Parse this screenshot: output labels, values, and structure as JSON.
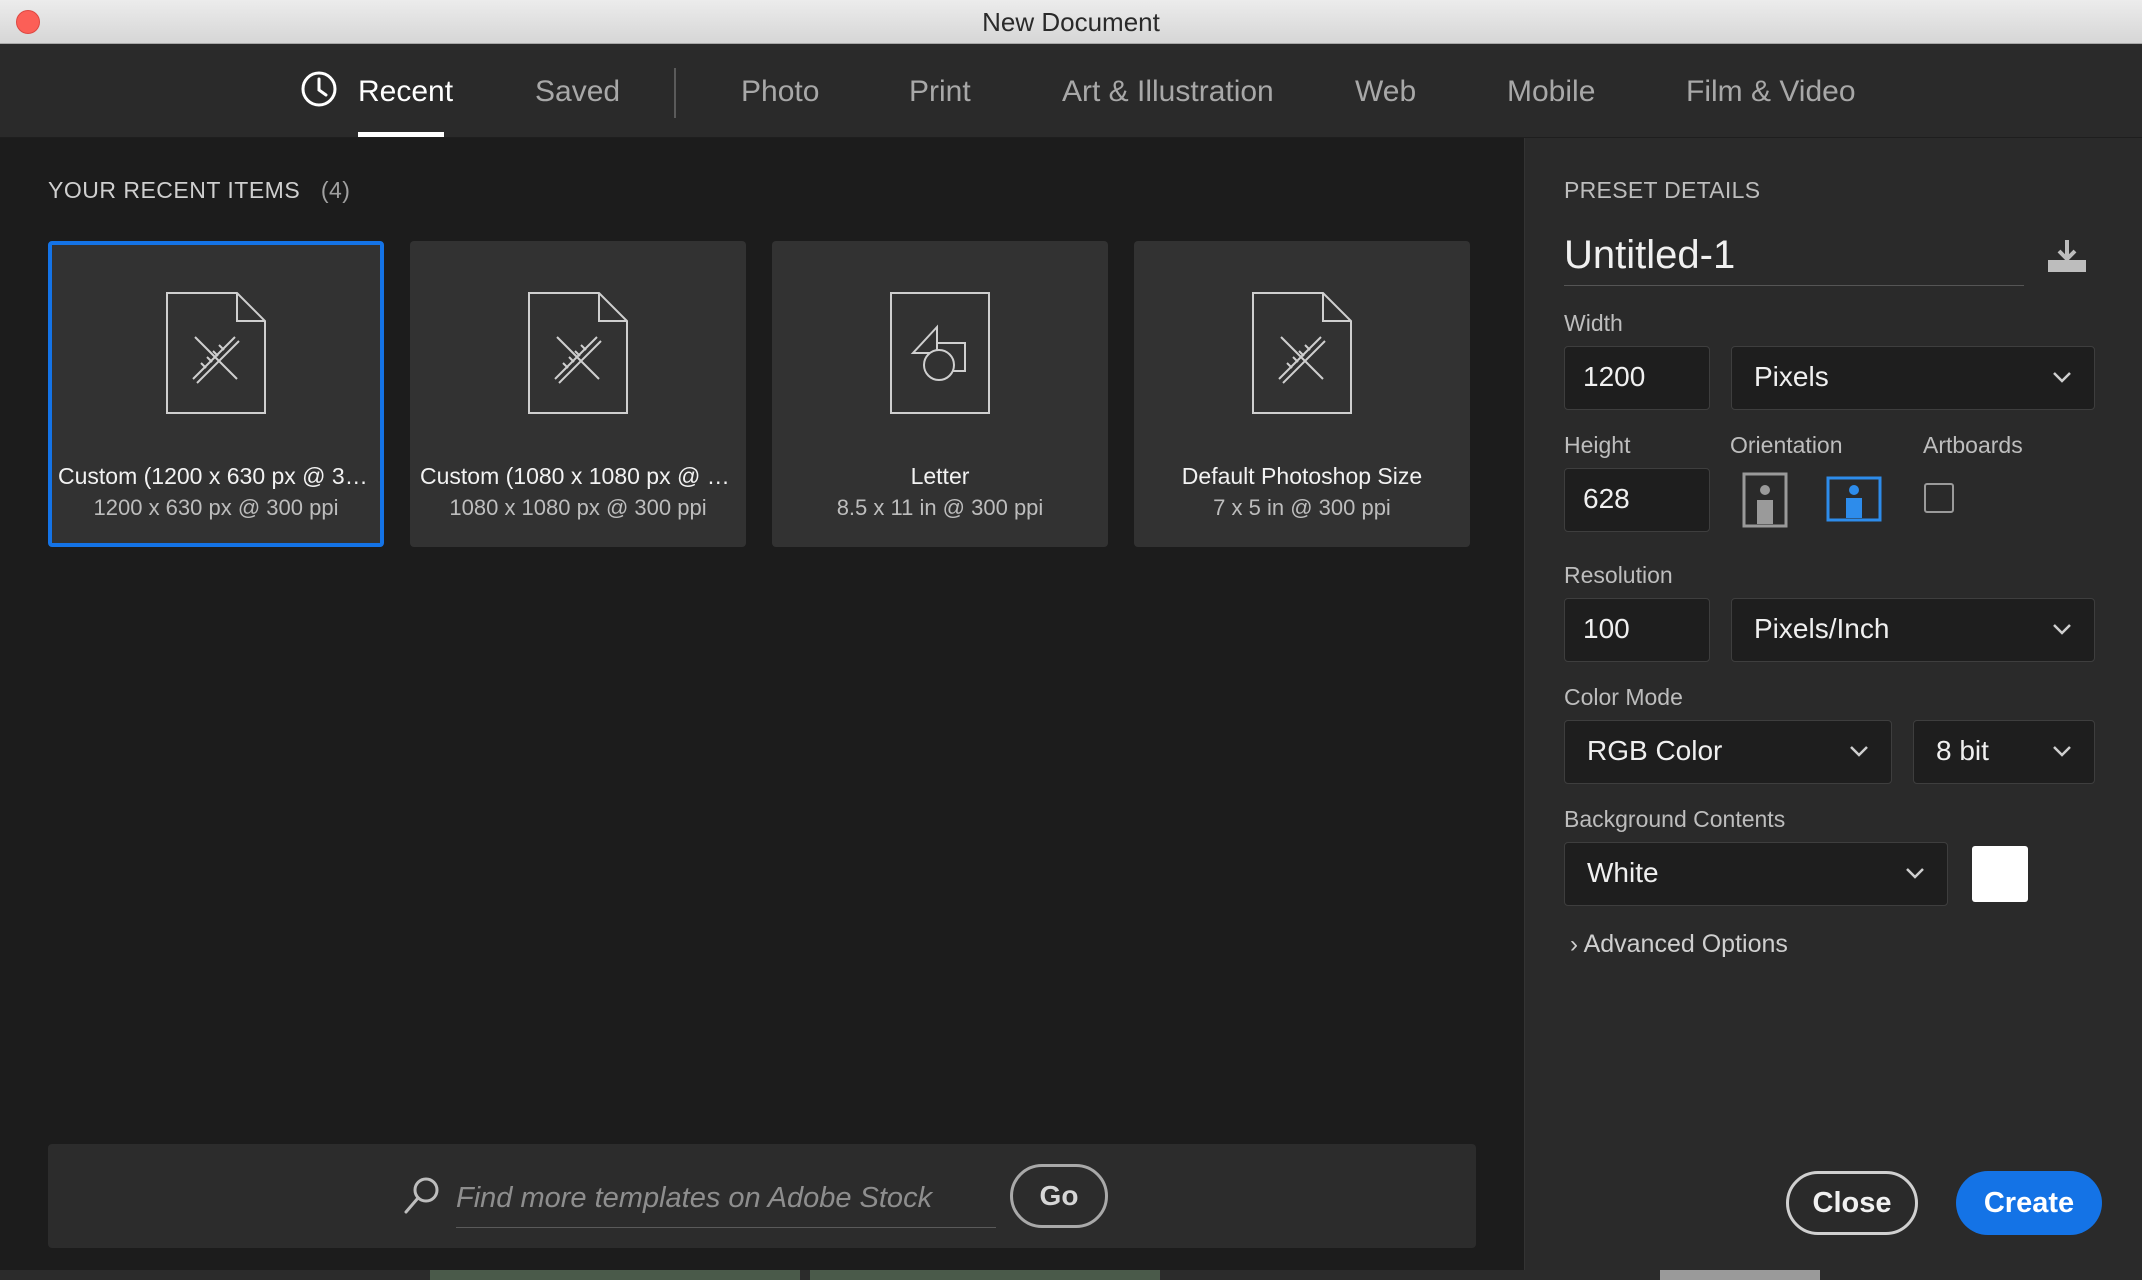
{
  "window": {
    "title": "New Document"
  },
  "tabs": [
    {
      "label": "Recent",
      "active": true
    },
    {
      "label": "Saved"
    },
    {
      "label": "Photo"
    },
    {
      "label": "Print"
    },
    {
      "label": "Art & Illustration"
    },
    {
      "label": "Web"
    },
    {
      "label": "Mobile"
    },
    {
      "label": "Film & Video"
    }
  ],
  "recent": {
    "title": "YOUR RECENT ITEMS",
    "count": "(4)",
    "items": [
      {
        "name": "Custom (1200 x 630 px @ 30...",
        "sub": "1200 x 630 px @ 300 ppi",
        "icon": "custom-document-icon"
      },
      {
        "name": "Custom (1080 x 1080 px @ 3...",
        "sub": "1080 x 1080 px @ 300 ppi",
        "icon": "custom-document-icon"
      },
      {
        "name": "Letter",
        "sub": "8.5 x 11 in @ 300 ppi",
        "icon": "print-document-icon"
      },
      {
        "name": "Default Photoshop Size",
        "sub": "7 x 5 in @ 300 ppi",
        "icon": "custom-document-icon"
      }
    ]
  },
  "stock": {
    "placeholder": "Find more templates on Adobe Stock",
    "go_label": "Go"
  },
  "preset": {
    "title": "PRESET DETAILS",
    "name": "Untitled-1",
    "width_label": "Width",
    "width_value": "1200",
    "width_unit": "Pixels",
    "height_label": "Height",
    "height_value": "628",
    "orientation_label": "Orientation",
    "artboards_label": "Artboards",
    "resolution_label": "Resolution",
    "resolution_value": "100",
    "resolution_unit": "Pixels/Inch",
    "color_mode_label": "Color Mode",
    "color_mode": "RGB Color",
    "bit_depth": "8 bit",
    "background_label": "Background Contents",
    "background": "White",
    "background_swatch": "#ffffff",
    "advanced_label": "Advanced Options"
  },
  "actions": {
    "close_label": "Close",
    "create_label": "Create"
  },
  "colors": {
    "accent": "#1473e6"
  }
}
